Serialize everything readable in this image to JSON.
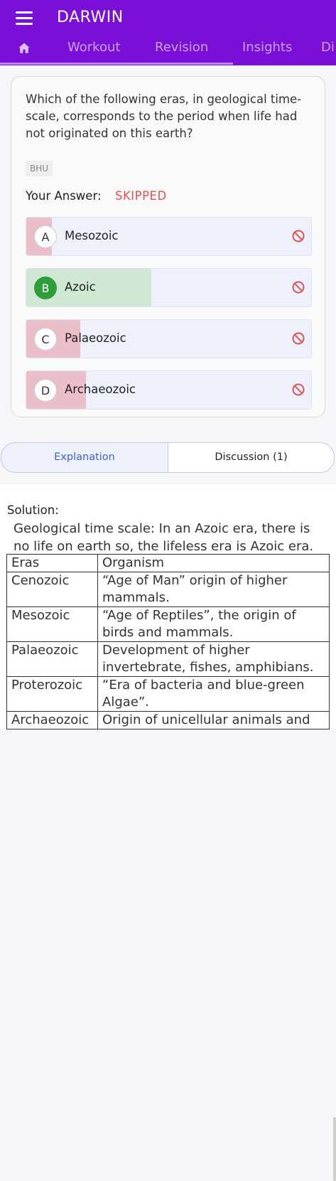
{
  "app": {
    "title": "DARWIN"
  },
  "nav_tabs": [
    {
      "label": "Workout"
    },
    {
      "label": "Revision"
    },
    {
      "label": "Insights"
    },
    {
      "label": "Di"
    }
  ],
  "question": {
    "text": "Which of the following eras, in geological time-scale, corresponds to the period when life had not originated on this earth?",
    "tag": "BHU",
    "your_answer_label": "Your Answer:",
    "your_answer_value": "SKIPPED"
  },
  "options": [
    {
      "letter": "A",
      "text": "Mesozoic",
      "percent": 9,
      "correct": false
    },
    {
      "letter": "B",
      "text": "Azoic",
      "percent": 44,
      "correct": true
    },
    {
      "letter": "C",
      "text": "Palaeozoic",
      "percent": 19,
      "correct": false
    },
    {
      "letter": "D",
      "text": "Archaeozoic",
      "percent": 21,
      "correct": false
    }
  ],
  "colors": {
    "accent": "#7a10d8",
    "wrong_fill": "#ebbfc9",
    "correct_fill": "#cfe8d3",
    "correct_badge": "#2e9e3a",
    "status_red": "#e05252",
    "link_blue": "#3a62d8"
  },
  "icons": {
    "menu": "menu-icon",
    "home": "home-icon",
    "no_answer": "ban-icon"
  },
  "detail_tabs": {
    "explanation": "Explanation",
    "discussion": "Discussion (1)"
  },
  "solution": {
    "label": "Solution:",
    "text": "Geological time scale: In an Azoic era, there is no life on earth so, the lifeless era is Azoic era.",
    "table": {
      "headers": [
        "Eras",
        "Organism"
      ],
      "rows": [
        [
          "Cenozoic",
          "“Age of Man” origin of higher mammals."
        ],
        [
          "Mesozoic",
          "“Age of Reptiles”, the origin of birds and mammals."
        ],
        [
          "Palaeozoic",
          "Development of higher invertebrate, fishes, amphibians."
        ],
        [
          "Proterozoic",
          "“Era of bacteria and blue-green Algae”."
        ],
        [
          "Archaeozoic",
          "Origin of unicellular animals and"
        ]
      ]
    }
  }
}
